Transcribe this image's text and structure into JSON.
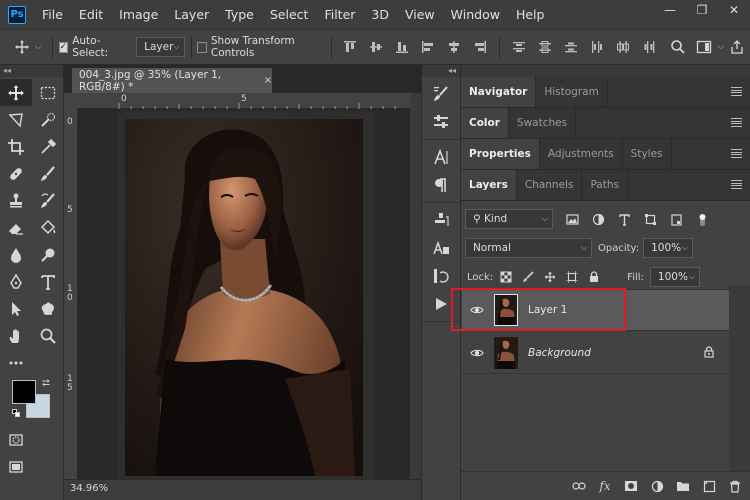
{
  "app": {
    "logo": "Ps"
  },
  "menu": [
    "File",
    "Edit",
    "Image",
    "Layer",
    "Type",
    "Select",
    "Filter",
    "3D",
    "View",
    "Window",
    "Help"
  ],
  "window_controls": {
    "minimize": "—",
    "restore": "❐",
    "close": "✕"
  },
  "options": {
    "auto_select_label": "Auto-Select:",
    "auto_select_value": "Layer",
    "show_transform_label": "Show Transform Controls"
  },
  "document": {
    "tab_title": "004_3.jpg @ 35% (Layer 1, RGB/8#) *",
    "close": "×",
    "zoom": "34.96%",
    "ruler_top": [
      "0",
      "5"
    ],
    "ruler_left": [
      "0",
      "5",
      "1\n0",
      "1\n5"
    ]
  },
  "panels": {
    "group1": [
      "Navigator",
      "Histogram"
    ],
    "group2": [
      "Color",
      "Swatches"
    ],
    "group3": [
      "Properties",
      "Adjustments",
      "Styles"
    ],
    "group4": [
      "Layers",
      "Channels",
      "Paths"
    ]
  },
  "layers_panel": {
    "kind_label": "Kind",
    "blend_mode": "Normal",
    "opacity_label": "Opacity:",
    "opacity_value": "100%",
    "lock_label": "Lock:",
    "fill_label": "Fill:",
    "fill_value": "100%",
    "layers": [
      {
        "name": "Layer 1",
        "selected": true
      },
      {
        "name": "Background",
        "locked": true
      }
    ]
  },
  "colors": {
    "highlight": "#e01b24",
    "foreground": "#000000",
    "background": "#c8d6e2"
  }
}
